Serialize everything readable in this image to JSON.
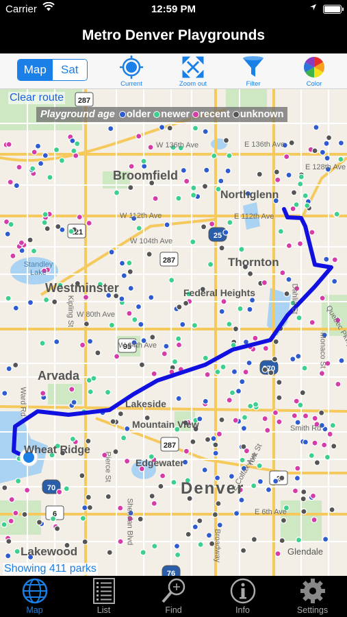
{
  "status": {
    "carrier": "Carrier",
    "time": "12:59 PM"
  },
  "title": "Metro Denver Playgrounds",
  "toolbar": {
    "map_type": {
      "map": "Map",
      "sat": "Sat",
      "selected": "Map"
    },
    "current_label": "Current",
    "zoom_out_label": "Zoom out",
    "filter_label": "Filter",
    "color_label": "Color"
  },
  "map": {
    "clear_route": "Clear route",
    "legend": {
      "title": "Playground age",
      "items": [
        {
          "label": "older",
          "color": "#2f5bd0"
        },
        {
          "label": "newer",
          "color": "#3ccf8e"
        },
        {
          "label": "recent",
          "color": "#d63ca8"
        },
        {
          "label": "unknown",
          "color": "#555555"
        }
      ]
    },
    "showing": "Showing 411 parks",
    "places": {
      "broomfield": "Broomfield",
      "northglenn": "Northglenn",
      "thornton": "Thornton",
      "westminster": "Westminster",
      "federal_heights": "Federal Heights",
      "arvada": "Arvada",
      "lakeside": "Lakeside",
      "mountain_view": "Mountain View",
      "wheat_ridge": "Wheat Ridge",
      "edgewater": "Edgewater",
      "denver": "Denver",
      "lakewood": "Lakewood",
      "glendale": "Glendale",
      "standley_lake": "Standley Lake"
    },
    "streets": {
      "w136": "W 136th Ave",
      "e136": "E 136th Ave",
      "e128": "E 128th Ave",
      "w112": "W 112th Ave",
      "e112": "E 112th Ave",
      "w104": "W 104th Ave",
      "w80": "W 80th Ave",
      "w64": "W 64th Ave",
      "smith": "Smith Rd",
      "e6": "E 6th Ave",
      "dahlia": "Dahlia St",
      "kipling": "Kipling St",
      "ward": "Ward Rd",
      "pierce": "Pierce St",
      "york": "York St",
      "broadway": "Broadway",
      "monaco": "Monaco St",
      "quebec": "Quebec Pkwy",
      "sheridan": "Sheridan Blvd",
      "colfax": "E Colfax Ave"
    },
    "shields": [
      "287",
      "121",
      "287",
      "25",
      "95",
      "270",
      "287",
      "2",
      "70",
      "6",
      "76"
    ],
    "route_color": "#1010e0"
  },
  "tabs": [
    {
      "label": "Map",
      "icon": "globe-icon",
      "active": true
    },
    {
      "label": "List",
      "icon": "list-icon",
      "active": false
    },
    {
      "label": "Find",
      "icon": "magnifier-icon",
      "active": false
    },
    {
      "label": "Info",
      "icon": "info-icon",
      "active": false
    },
    {
      "label": "Settings",
      "icon": "gear-icon",
      "active": false
    }
  ]
}
